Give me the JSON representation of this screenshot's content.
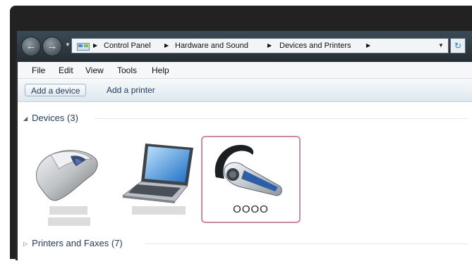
{
  "breadcrumb": {
    "items": [
      "Control Panel",
      "Hardware and Sound",
      "Devices and Printers"
    ]
  },
  "menu": {
    "items": [
      "File",
      "Edit",
      "View",
      "Tools",
      "Help"
    ]
  },
  "commands": {
    "add_device": "Add a device",
    "add_printer": "Add a printer"
  },
  "groups": {
    "devices": "Devices (3)",
    "printers": "Printers and Faxes (7)"
  },
  "devices": [
    {
      "icon": "mouse-icon",
      "label": ""
    },
    {
      "icon": "laptop-icon",
      "label": ""
    },
    {
      "icon": "headset-icon",
      "label": "OOOO"
    }
  ],
  "colors": {
    "selection_border": "#c98aa8",
    "group_text": "#1e395b"
  }
}
